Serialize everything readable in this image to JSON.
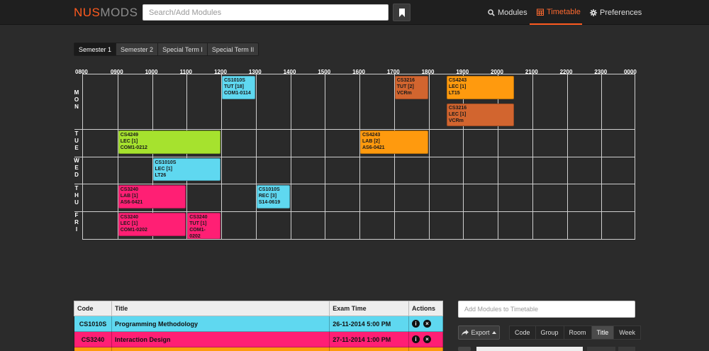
{
  "app": {
    "logo_part1": "NUS",
    "logo_part2": "MODS",
    "search_placeholder": "Search/Add Modules"
  },
  "nav": {
    "modules": "Modules",
    "timetable": "Timetable",
    "preferences": "Preferences"
  },
  "semester_tabs": [
    "Semester 1",
    "Semester 2",
    "Special Term I",
    "Special Term II"
  ],
  "timetable": {
    "hours": [
      "0800",
      "0900",
      "1000",
      "1100",
      "1200",
      "1300",
      "1400",
      "1500",
      "1600",
      "1700",
      "1800",
      "1900",
      "2000",
      "2100",
      "2200",
      "2300",
      "0000"
    ],
    "days": [
      {
        "label": "MON",
        "rows": 2
      },
      {
        "label": "TUE",
        "rows": 1
      },
      {
        "label": "WED",
        "rows": 1
      },
      {
        "label": "THU",
        "rows": 1
      },
      {
        "label": "FRI",
        "rows": 1
      }
    ],
    "lessons": [
      {
        "day": 0,
        "row": 0,
        "start": 12.0,
        "end": 13.0,
        "color": "#5fd8f0",
        "code": "CS1010S",
        "type": "TUT [18]",
        "venue": "COM1-0114"
      },
      {
        "day": 0,
        "row": 0,
        "start": 17.0,
        "end": 18.0,
        "color": "#d2652f",
        "code": "CS3216",
        "type": "TUT [2]",
        "venue": "VCRm"
      },
      {
        "day": 0,
        "row": 0,
        "start": 18.5,
        "end": 20.5,
        "color": "#ff9a0e",
        "code": "CS4243",
        "type": "LEC [1]",
        "venue": "LT15"
      },
      {
        "day": 0,
        "row": 1,
        "start": 18.5,
        "end": 20.5,
        "color": "#d2652f",
        "code": "CS3216",
        "type": "LEC [1]",
        "venue": "VCRm"
      },
      {
        "day": 1,
        "row": 0,
        "start": 9.0,
        "end": 12.0,
        "color": "#a6e22e",
        "code": "CS4249",
        "type": "LEC [1]",
        "venue": "COM1-0212"
      },
      {
        "day": 1,
        "row": 0,
        "start": 16.0,
        "end": 18.0,
        "color": "#ff9a0e",
        "code": "CS4243",
        "type": "LAB [2]",
        "venue": "AS6-0421"
      },
      {
        "day": 2,
        "row": 0,
        "start": 10.0,
        "end": 12.0,
        "color": "#5fd8f0",
        "code": "CS1010S",
        "type": "LEC [1]",
        "venue": "LT26"
      },
      {
        "day": 3,
        "row": 0,
        "start": 9.0,
        "end": 11.0,
        "color": "#ff1f74",
        "code": "CS3240",
        "type": "LAB [1]",
        "venue": "AS6-0421"
      },
      {
        "day": 3,
        "row": 0,
        "start": 13.0,
        "end": 14.0,
        "color": "#5fd8f0",
        "code": "CS1010S",
        "type": "REC [3]",
        "venue": "S14-0619"
      },
      {
        "day": 4,
        "row": 0,
        "start": 9.0,
        "end": 11.0,
        "color": "#ff1f74",
        "code": "CS3240",
        "type": "LEC [1]",
        "venue": "COM1-0202"
      },
      {
        "day": 4,
        "row": 0,
        "start": 11.0,
        "end": 12.0,
        "color": "#ff1f74",
        "code": "CS3240",
        "type": "TUT [1]",
        "venue": "COM1-\n0202"
      }
    ]
  },
  "module_table": {
    "headers": {
      "code": "Code",
      "title": "Title",
      "exam": "Exam Time",
      "actions": "Actions"
    },
    "rows": [
      {
        "code": "CS1010S",
        "title": "Programming Methodology",
        "exam": "26-11-2014 5:00 PM",
        "color": "#5fd8f0"
      },
      {
        "code": "CS3240",
        "title": "Interaction Design",
        "exam": "27-11-2014 1:00 PM",
        "color": "#ff1f74"
      },
      {
        "code": "",
        "title": "",
        "exam": "",
        "color": "#ff9a0e"
      }
    ]
  },
  "right_panel": {
    "add_placeholder": "Add Modules to Timetable",
    "export_label": "Export",
    "view_options": [
      "Code",
      "Group",
      "Room",
      "Title",
      "Week"
    ],
    "active_view": "Title"
  }
}
